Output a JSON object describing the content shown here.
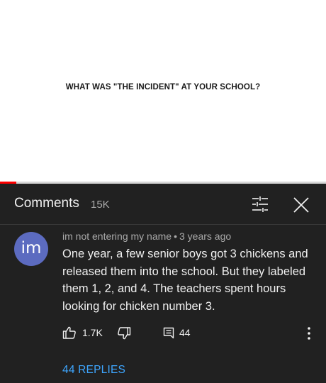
{
  "video": {
    "caption": "WHAT WAS \"THE INCIDENT\" AT YOUR SCHOOL?",
    "progress_fraction": 0.05
  },
  "header": {
    "title": "Comments",
    "count": "15K",
    "filter_icon": "sort-filter-icon",
    "close_icon": "close-icon"
  },
  "comment": {
    "avatar_text": "im",
    "author": "im not entering my name",
    "separator": "•",
    "time": "3 years ago",
    "text": "One year, a few senior boys got 3 chickens and released them into the school. But they labeled them 1, 2, and 4. The teachers spent hours looking for chicken number 3.",
    "likes": "1.7K",
    "reply_count": "44",
    "replies_link": "44 REPLIES"
  },
  "colors": {
    "panel_bg": "#212121",
    "accent_link": "#3ea6ff",
    "avatar_bg": "#5c6bc0",
    "progress": "#ff0000"
  }
}
